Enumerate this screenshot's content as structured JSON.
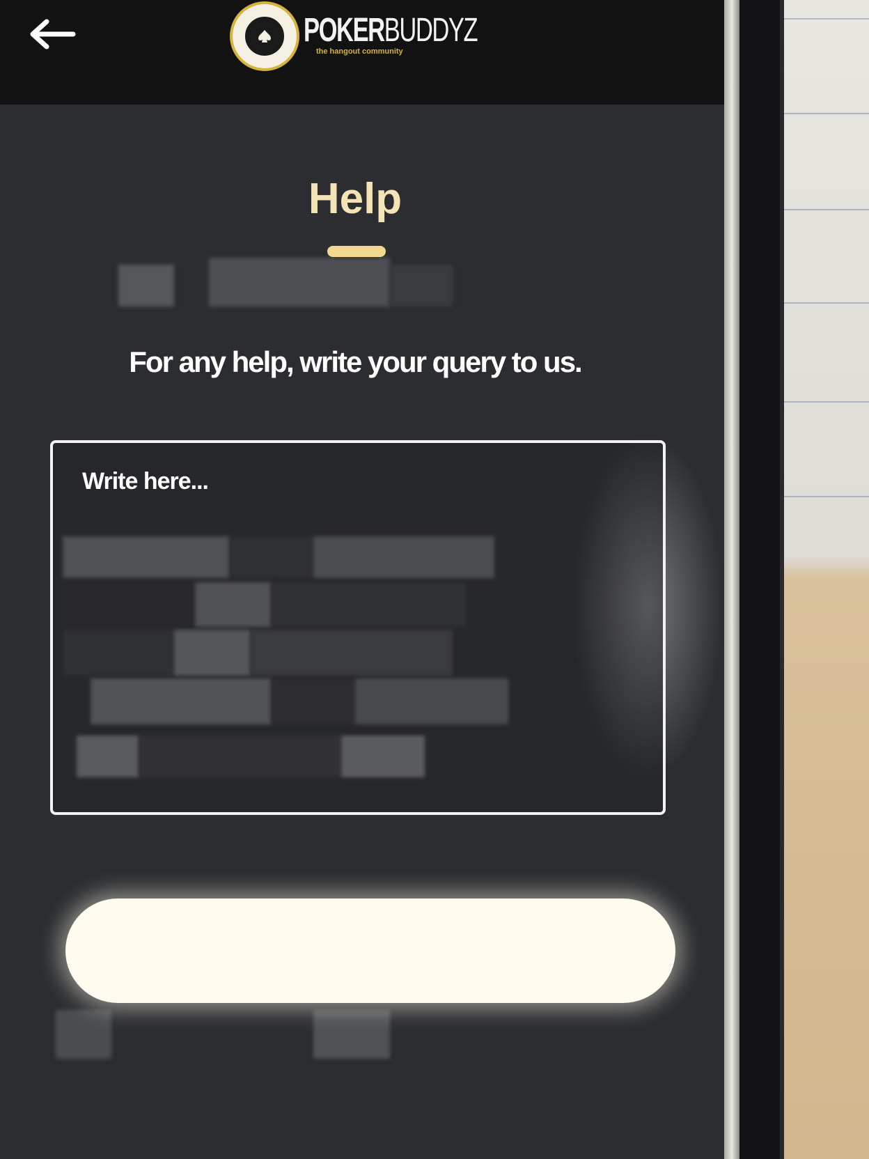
{
  "header": {
    "back_icon": "arrow-left-icon",
    "logo": {
      "word_bold": "POKER",
      "word_light": "BUDDYZ",
      "tagline": "the hangout community"
    }
  },
  "main": {
    "title": "Help",
    "prompt": "For any help, write your query to us.",
    "query_placeholder": "Write here...",
    "query_value": "",
    "submit_label": ""
  },
  "colors": {
    "title": "#f4e3b5",
    "underline": "#f2d98f",
    "logo_gold": "#d6b33a",
    "button": "#fffbee",
    "header_bg": "#121213"
  }
}
